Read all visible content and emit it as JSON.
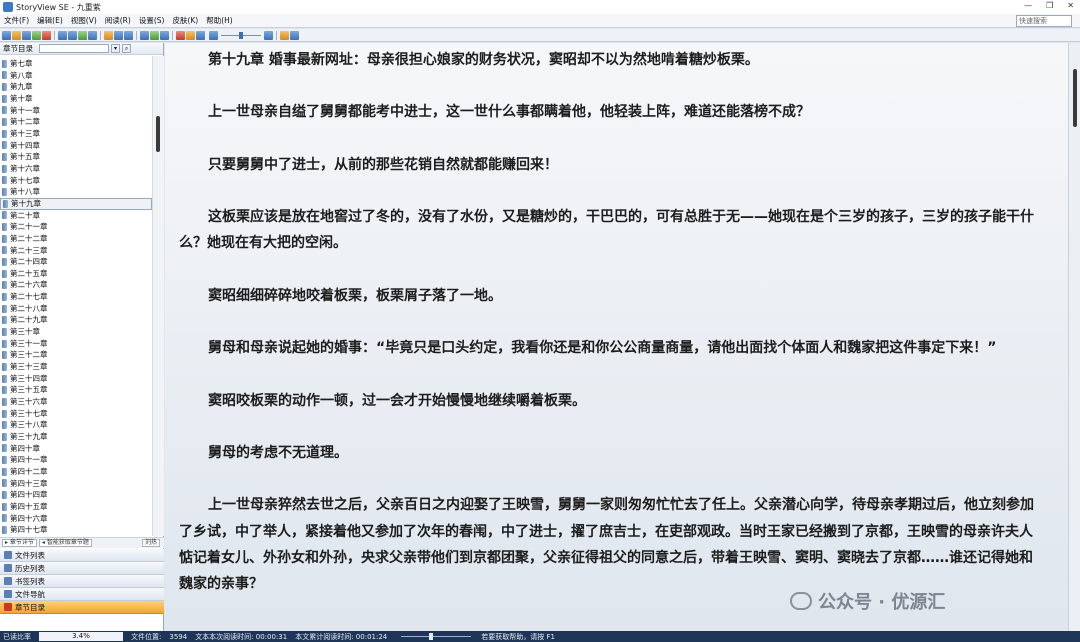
{
  "window": {
    "title": "StoryView SE - 九重紫",
    "controls": [
      "—",
      "❐",
      "✕"
    ]
  },
  "menu": [
    "文件(F)",
    "编辑(E)",
    "视图(V)",
    "阅读(R)",
    "设置(S)",
    "皮肤(K)",
    "帮助(H)"
  ],
  "quick_search": {
    "placeholder": "快速搜索"
  },
  "sidebar": {
    "title": "章节目录",
    "chapters": [
      "第七章",
      "第八章",
      "第九章",
      "第十章",
      "第十一章",
      "第十二章",
      "第十三章",
      "第十四章",
      "第十五章",
      "第十六章",
      "第十七章",
      "第十八章",
      "第十九章",
      "第二十章",
      "第二十一章",
      "第二十二章",
      "第二十三章",
      "第二十四章",
      "第二十五章",
      "第二十六章",
      "第二十七章",
      "第二十八章",
      "第二十九章",
      "第三十章",
      "第三十一章",
      "第三十二章",
      "第三十三章",
      "第三十四章",
      "第三十五章",
      "第三十六章",
      "第三十七章",
      "第三十八章",
      "第三十九章",
      "第四十章",
      "第四十一章",
      "第四十二章",
      "第四十三章",
      "第四十四章",
      "第四十五章",
      "第四十六章",
      "第四十七章"
    ],
    "selected_index": 12,
    "bottom": [
      "▸ 章节详节",
      "◂ 智能获取章节题",
      "刘热"
    ],
    "nav_groups": [
      "文件列表",
      "历史列表",
      "书签列表",
      "文件导航",
      "章节目录"
    ],
    "active_group": 4
  },
  "paragraphs": [
    "第十九章 婚事最新网址：母亲很担心娘家的财务状况，窦昭却不以为然地啃着糖炒板栗。",
    "上一世母亲自缢了舅舅都能考中进士，这一世什么事都瞒着他，他轻装上阵，难道还能落榜不成？",
    "只要舅舅中了进士，从前的那些花销自然就都能赚回来！",
    "这板栗应该是放在地窖过了冬的，没有了水份，又是糖炒的，干巴巴的，可有总胜于无——她现在是个三岁的孩子，三岁的孩子能干什么？她现在有大把的空闲。",
    "窦昭细细碎碎地咬着板栗，板栗屑子落了一地。",
    "舅母和母亲说起她的婚事：“毕竟只是口头约定，我看你还是和你公公商量商量，请他出面找个体面人和魏家把这件事定下来！”",
    "窦昭咬板栗的动作一顿，过一会才开始慢慢地继续嚼着板栗。",
    "舅母的考虑不无道理。",
    "上一世母亲猝然去世之后，父亲百日之内迎娶了王映雪，舅舅一家则匆匆忙忙去了任上。父亲潜心向学，待母亲孝期过后，他立刻参加了乡试，中了举人，紧接着他又参加了次年的春闱，中了进士，擢了庶吉士，在吏部观政。当时王家已经搬到了京都，王映雪的母亲许夫人惦记着女儿、外孙女和外孙，央求父亲带他们到京都团聚，父亲征得祖父的同意之后，带着王映雪、窦明、窦晓去了京都……谁还记得她和魏家的亲事？"
  ],
  "status": {
    "read_ratio_label": "已读比率",
    "read_ratio": "3.4%",
    "file_pos_label": "文件位置:",
    "file_pos": "3594",
    "session_time": "文本本次阅读时间: 00:00:31",
    "total_time": "本文累计阅读时间: 00:01:24",
    "help": "若要获取帮助，请按 F1"
  },
  "watermark": "公众号 · 优源汇"
}
